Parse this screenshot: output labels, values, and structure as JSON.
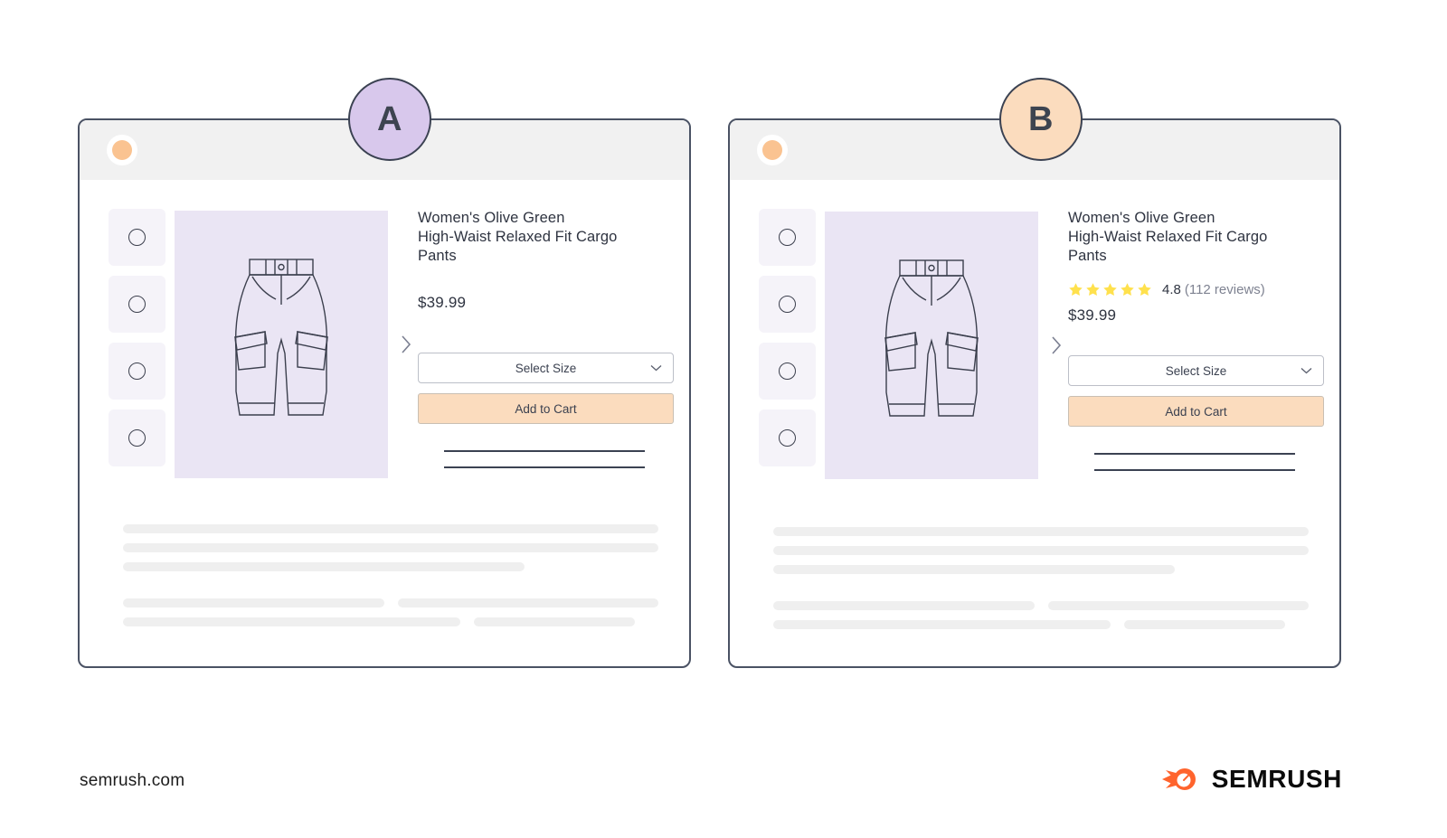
{
  "variants": [
    {
      "id": "a",
      "badge_label": "A",
      "badge_color": "#d8c8ec",
      "header_dot_color": "#fac391",
      "product": {
        "title": "Women's Olive Green\nHigh-Waist Relaxed Fit Cargo Pants",
        "price": "$39.99",
        "has_rating": false,
        "size_select_label": "Select Size",
        "add_to_cart_label": "Add to Cart"
      },
      "thumbnails": [
        "thumbnail-1",
        "thumbnail-2",
        "thumbnail-3",
        "thumbnail-4"
      ]
    },
    {
      "id": "b",
      "badge_label": "B",
      "badge_color": "#fbdcbe",
      "header_dot_color": "#fac391",
      "product": {
        "title": "Women's Olive Green\nHigh-Waist Relaxed Fit Cargo Pants",
        "price": "$39.99",
        "has_rating": true,
        "rating_value": "4.8",
        "rating_count": "(112 reviews)",
        "stars_filled": 5,
        "star_color": "#ffe14d",
        "size_select_label": "Select Size",
        "add_to_cart_label": "Add to Cart"
      },
      "thumbnails": [
        "thumbnail-1",
        "thumbnail-2",
        "thumbnail-3",
        "thumbnail-4"
      ]
    }
  ],
  "footer": {
    "url": "semrush.com",
    "brand_name": "SEMRUSH",
    "brand_color": "#ff642d"
  },
  "colors": {
    "panel_border": "#4a5264",
    "header_bg": "#f1f1f1",
    "hero_bg": "#eae5f4",
    "thumb_bg": "#f5f3f9",
    "cta_bg": "#fbdcbe",
    "skeleton": "#efefef",
    "text_primary": "#2f3441",
    "text_muted": "#7e8291"
  }
}
